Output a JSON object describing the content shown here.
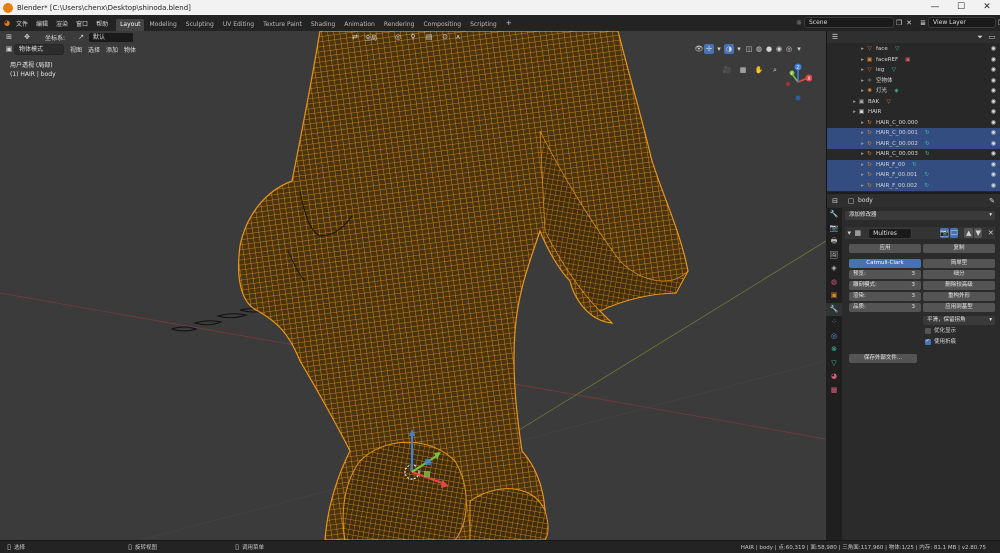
{
  "window": {
    "title": "Blender* [C:\\Users\\chenx\\Desktop\\shinoda.blend]",
    "controls": [
      "—",
      "☐",
      "✕"
    ]
  },
  "menu": [
    "文件",
    "编辑",
    "渲染",
    "窗口",
    "帮助"
  ],
  "workspaces": [
    "Layout",
    "Modeling",
    "Sculpting",
    "UV Editing",
    "Texture Paint",
    "Shading",
    "Animation",
    "Rendering",
    "Compositing",
    "Scripting"
  ],
  "workspace_active": "Layout",
  "scene": {
    "name": "Scene",
    "view_layer": "View Layer"
  },
  "viewport": {
    "mode": "物体模式",
    "menus": [
      "视图",
      "选择",
      "添加",
      "物体"
    ],
    "orientation_label": "坐标系:",
    "orientation": "默认",
    "transform_pivot": "全局",
    "view_name": "用户透视 (局部)",
    "active_object": "(1) HAIR | body",
    "gizmo_axes": [
      "X",
      "Y",
      "Z"
    ],
    "mesh_color": "#e8951c"
  },
  "outliner": {
    "rows": [
      {
        "name": "face",
        "icon": "▽",
        "iconColor": "#e0862e",
        "selected": false,
        "indent": 2,
        "badge": "▽",
        "badgeColor": "#37c0a4"
      },
      {
        "name": "faceREF",
        "icon": "▣",
        "iconColor": "#e0862e",
        "selected": false,
        "indent": 2,
        "badge": "▣",
        "badgeColor": "#d85a77"
      },
      {
        "name": "leg",
        "icon": "▽",
        "iconColor": "#e0862e",
        "selected": false,
        "indent": 2,
        "badge": "▽",
        "badgeColor": "#37c0a4"
      },
      {
        "name": "空物体",
        "icon": "✛",
        "iconColor": "#888",
        "selected": false,
        "indent": 2,
        "badge": "",
        "badgeColor": ""
      },
      {
        "name": "灯光",
        "icon": "✺",
        "iconColor": "#e0862e",
        "selected": false,
        "indent": 2,
        "badge": "◈",
        "badgeColor": "#37c0a4"
      },
      {
        "name": "BAK",
        "icon": "▣",
        "iconColor": "#aaa",
        "selected": false,
        "indent": 1,
        "badge": "▽",
        "badgeColor": "#e0862e"
      },
      {
        "name": "HAIR",
        "icon": "▣",
        "iconColor": "#ddd",
        "selected": false,
        "indent": 1,
        "badge": "",
        "badgeColor": ""
      },
      {
        "name": "HAIR_C_00.000",
        "icon": "↻",
        "iconColor": "#e0862e",
        "selected": false,
        "indent": 2,
        "badge": "",
        "badgeColor": ""
      },
      {
        "name": "HAIR_C_00.001",
        "icon": "↻",
        "iconColor": "#e0862e",
        "selected": true,
        "indent": 2,
        "badge": "↻",
        "badgeColor": "#37c0a4"
      },
      {
        "name": "HAIR_C_00.002",
        "icon": "↻",
        "iconColor": "#e0862e",
        "selected": true,
        "indent": 2,
        "badge": "↻",
        "badgeColor": "#37c0a4"
      },
      {
        "name": "HAIR_C_00.003",
        "icon": "↻",
        "iconColor": "#e0862e",
        "selected": false,
        "indent": 2,
        "badge": "↻",
        "badgeColor": "#37c0a4"
      },
      {
        "name": "HAIR_F_00",
        "icon": "↻",
        "iconColor": "#e0862e",
        "selected": true,
        "indent": 2,
        "badge": "↻",
        "badgeColor": "#37c0a4"
      },
      {
        "name": "HAIR_F_00.001",
        "icon": "↻",
        "iconColor": "#e0862e",
        "selected": true,
        "indent": 2,
        "badge": "↻",
        "badgeColor": "#37c0a4"
      },
      {
        "name": "HAIR_F_00.002",
        "icon": "↻",
        "iconColor": "#e0862e",
        "selected": true,
        "indent": 2,
        "badge": "↻",
        "badgeColor": "#37c0a4"
      }
    ]
  },
  "properties": {
    "object_name": "body",
    "add_modifier": "添加修改器",
    "modifier": {
      "name": "Multires",
      "apply": "应用",
      "copy": "复制",
      "catmull_clark": "Catmull-Clark",
      "simple": "简单型",
      "preview_label": "预览:",
      "preview_value": "3",
      "sculpt_label": "雕刻模式:",
      "sculpt_value": "3",
      "render_label": "渲染:",
      "render_value": "3",
      "quality_label": "品质:",
      "quality_value": "3",
      "subdivide": "细分",
      "delete_higher": "删除较高级",
      "reshape": "重构外形",
      "apply_base": "应用到基型",
      "uv_smooth": "平滑，保留拐角",
      "optimal_display": "优化显示",
      "use_creases": "使用折痕",
      "optimal_display_on": false,
      "use_creases_on": true,
      "save_external": "保存外部文件..."
    }
  },
  "status": {
    "left_items": [
      "选择",
      "旋转视图",
      "调用菜单"
    ],
    "stats": "HAIR | body | 点:60,319 | 面:58,980 | 三角面:117,960 | 物体:1/25 | 内存: 81.1 MB | v2.80.75"
  }
}
